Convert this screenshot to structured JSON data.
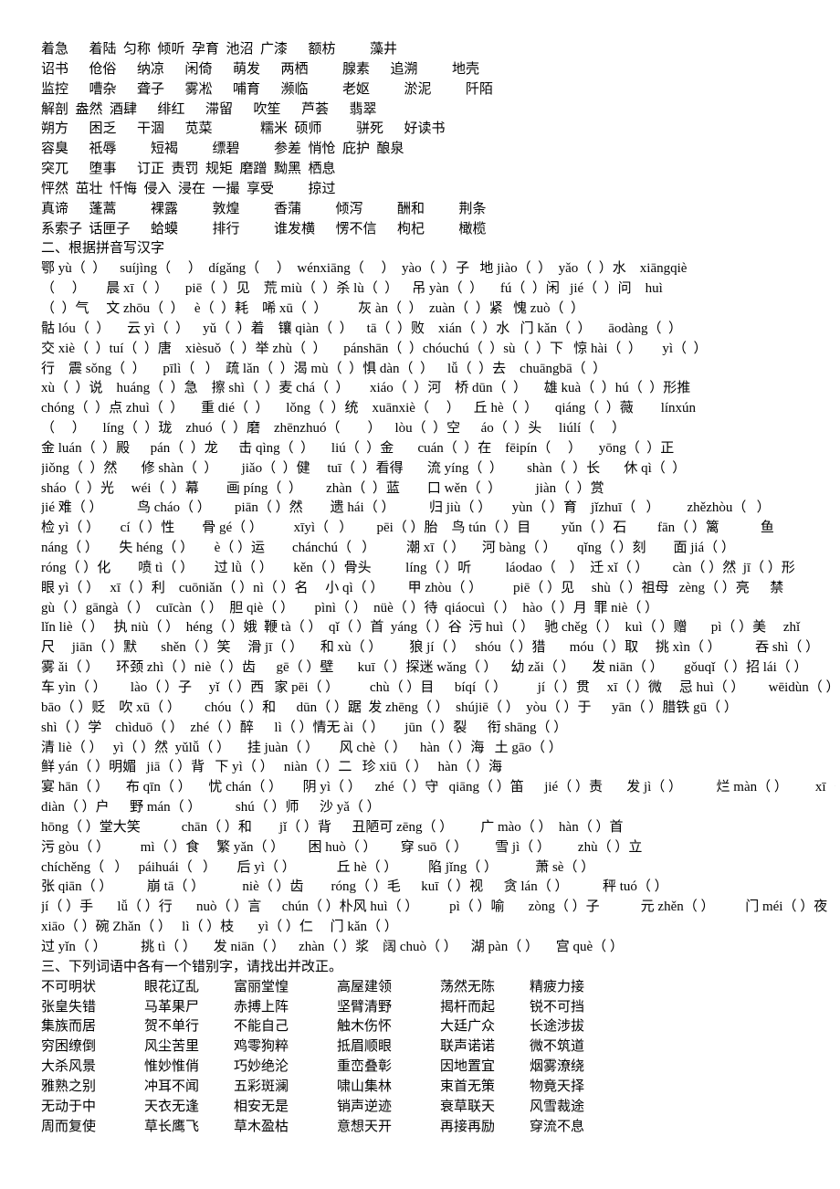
{
  "section1": {
    "lines": [
      "着急      着陆  匀称  倾听  孕育  池沼  广漆      额枋          藻井",
      "诏书      伧俗      纳凉      闲倚      萌发      两栖          腺素      追溯          地壳",
      "监控      嘈杂      聋子      雾凇      哺育      濒临          老妪          淤泥          阡陌",
      "解剖  盎然  酒肆      绯红      滞留      吹笙      芦荟      翡翠",
      "朔方      困乏      干涸      苋菜              糯米  硕师          骈死      好读书",
      "容臭      祇辱          短褐          缥碧          参差  悄怆  庇护  酿泉",
      "突兀      堕事      订正  责罚  规矩  磨蹭  黝黑  栖息",
      "怦然  茁壮  忏悔  侵入  浸在  一撮  享受          掠过",
      "真谛      蓬蒿          裸露          敦煌          香蒲          倾泻          酬和          荆条",
      "系索子  话匣子      蛤蟆          排行          谁发横      愣不信      枸杞          橄榄"
    ]
  },
  "section2": {
    "heading": "二、根据拼音写汉字",
    "lines": [
      "鄂 yù（  ）    suíjìng（     ）  dígǎng（     ）  wénxiāng（     ）  yào（  ）子   地 jiào（  ）  yǎo（  ）水    xiāngqiè",
      "（     ）      晨 xī（  ）     piē（  ）见    荒 miù（  ）杀 lù（  ）    吊 yàn（  ）     fú（  ）闲   jié（  ）问    huì",
      "（  ）气     文 zhōu（  ）   è（  ）耗    唏 xū（  ）         灰 àn（  ）  zuàn（  ）紧   愧 zuò（  ）",
      "骷 lóu（  ）     云 yì（  ）    yǔ（  ）着    镶 qiàn（  ）    tā（  ）败    xián（  ）水   门 kǎn（  ）     āodàng（  ）",
      "交 xiè（  ）tuí（  ）唐    xièsuǒ（  ）举 zhù（  ）     pánshān（  ）chóuchú（  ）sù（  ）下   惊 hài（  ）      yì（  ）",
      "行    震 sǒng（  ）     pīlì（   ）  疏 lǎn（  ）渴 mù（  ）惧 dàn（  ）    lǚ（  ）去    chuāngbā（  ）",
      "xù（  ）说    huáng（  ）急    擦 shì（  ）麦 chá（  ）      xiáo（  ）河    桥 dūn（  ）     雄 kuà（  ）hú（  ）形推",
      "chóng（  ）点 zhuì（  ）     重 dié（  ）     lǒng（  ）统    xuānxiè（     ）    丘 hè（  ）     qiáng（  ）薇        línxún",
      "（     ）     líng（  ）珑    zhuó（  ）磨    zhēnzhuó（        ）    lòu（  ）空      áo（  ）头     liúlí（     ）",
      "金 luán（  ）殿      pán（  ）龙      击 qìng（  ）     liú（  ）金       cuán（  ）在    fēipín（     ）     yōng（  ）正",
      "jiǒng（  ）然       修 shàn（  ）       jiǎo（  ）健     tuī（  ）看得       流 yíng（  ）       shàn（  ）长       休 qì（  ）",
      "sháo（  ）光     wéi（  ）幕        画 píng（  ）       zhàn（  ）蓝        口 wěn（  ）          jiàn（  ）赏",
      "jié 难（ ）          鸟 cháo（ ）       piān（ ）然        遗 hái（ ）          归 jiù（ ）      yùn（ ）育    jǐzhuī（   ）        zhězhòu（   ）",
      "检 yì（ ）      cí（ ）性        骨 gé（ ）         xīyì（   ）       pēi（ ）胎    鸟 tún（ ）目         yǔn（ ）石         fān（ ）篱            鱼",
      "náng（ ）      失 héng（ ）      è（ ）运        chánchú（   ）         潮 xī（ ）     河 bàng（ ）      qǐng（ ）刻        面 jiá（ ）",
      "róng（ ）化        喷 tì（ ）      过 lǜ（ ）      kěn（ ）骨头          líng（ ）听          láodao（    ）  迁 xǐ（ ）       càn（ ）然  jī（ ）形",
      "眼 yì（ ）   xī（ ）利    cuōniǎn（ ）nì（ ）名     小 qì（ ）       甲 zhòu（ ）         piē（ ）见     shù（ ）祖母   zèng（ ）亮      禁",
      "gù（ ）gāngà（ ）  cuīcàn（ ）  胆 qiè（ ）      pìnì（ ）  nüè（ ）待  qiáocuì（ ）  hào（ ）月  罪 niè（ ）",
      "lǐn liè（ ）   执 niù（ ）  héng（ ）娥  鞭 tà（ ）  qǐ（ ）首  yáng（ ）谷  污 huì（ ）   驰 chěg（ ）  kuì（ ）赠       pì（ ）美     zhǐ",
      "尺     jiān（ ）默       shěn（ ）笑     滑 jī（ ）     和 xù（ ）        狼 jí（ ）   shóu（ ）猎       móu（ ）取     挑 xìn（ ）          吞 shì（ ）",
      "雾 ǎi（ ）     环颈 zhì（ ）niè（ ）齿      gē（ ）壁       kuī（ ）探迷 wǎng（ ）    幼 zǎi（ ）     发 niān（ ）      gǒuqǐ（ ）招 lái（ ）",
      "车 yìn（ ）       lào（ ）子     yǐ（ ）西   家 pēi（ ）         chù（ ）目      bíqí（ ）         jí（ ）贯     xī（ ）微     忌 huì（ ）       wēidùn（ ）",
      "bāo（ ）贬    吹 xū（ ）       chóu（ ）和      dūn（ ）踞  发 zhēng（ ）  shújiē（ ）  yòu（ ）于      yān（ ）腊铁 gū（ ）",
      "shì（ ）学    chìduō（ ）  zhé（ ）醉      lì（ ）情无 ài（ ）      jūn（ ）裂      衔 shāng（ ）",
      "清 liè（ ）   yì（ ）然  yǔlǚ（ ）     挂 juàn（ ）      风 chè（ ）    hàn（ ）海   土 gāo（ ）",
      "鲜 yán（ ）明媚   jiā（ ）背   下 yì（ ）   niàn（ ）二   珍 xiū（ ）   hàn（ ）海",
      "宴 hān（ ）     布 qīn（ ）     忧 chán（ ）      阴 yì（ ）    zhé（ ）守   qiāng（ ）笛      jié（ ）责       发 jì（ ）          烂 màn（ ）        xī（ ）戏",
      "diàn（ ）户      野 mán（ ）          shú（ ）师      沙 yǎ（ ）",
      "hōng（ ）堂大笑            chān（ ）和        jǐ（ ）背      丑陋可 zēng（ ）        广 mào（ ）  hàn（ ）首",
      "污 gòu（ ）         mì（ ）食     繁 yǎn（ ）       困 huò（ ）       穿 suō（ ）        雪 jì（ ）        zhù（ ）立",
      "chíchěng（   ）   páihuái（   ）      后 yì（ ）            丘 hè（ ）         陷 jǐng（ ）           萧 sè（ ）",
      "张 qiān（ ）          崩 tā（ ）           niè（ ）齿        róng（ ）毛      kuī（ ）视      贪 lán（ ）          秤 tuó（ ）",
      "jí（ ）手       lǚ（ ）行       nuò（ ）言      chún（ ）朴风 huì（ ）         pì（ ）喻       zòng（ ）子            元 zhěn（ ）         门 méi（ ）夜",
      "xiāo（ ）碗 Zhǎn（ ）   lì（ ）枝       yì（ ）仁     门 kǎn（ ）",
      "过 yǐn（ ）          挑 tì（ ）     发 niān（ ）    zhàn（ ）浆    阔 chuò（ ）    湖 pàn（ ）     宫 què（ ）"
    ]
  },
  "section3": {
    "heading": "三、下列词语中各有一个错别字，请找出并改正。",
    "rows": [
      [
        "不可明状",
        "眼花辽乱",
        "富丽堂惶",
        "高屋建领",
        "荡然无陈",
        "精疲力接"
      ],
      [
        "张皇失错",
        "马革果尸",
        "赤搏上阵",
        "坚臂清野",
        "揭杆而起",
        "锐不可挡"
      ],
      [
        "集族而居",
        "贺不单行",
        "不能自己",
        "触木伤怀",
        "大廷广众",
        "长途涉拔"
      ],
      [
        "穷困缭倒",
        "风尘苦里",
        "鸡零狗粹",
        "抵眉顺眼",
        "联声诺诺",
        "微不筑道"
      ],
      [
        "大杀风景",
        "惟妙惟俏",
        "巧妙绝沦",
        "重峦叠彰",
        "因地置宜",
        "烟雾潦绕"
      ],
      [
        "雅熟之别",
        "冲耳不闻",
        "五彩斑澜",
        "啸山集林",
        "束首无策",
        "物竟天择"
      ],
      [
        "无动于中",
        "天衣无逢",
        "相安无是",
        "销声逆迹",
        "衰草联天",
        "风雪裁途"
      ],
      [
        "周而复使",
        "草长鹰飞",
        "草木盈枯",
        "意想天开",
        "再接再励",
        "穿流不息"
      ]
    ]
  }
}
